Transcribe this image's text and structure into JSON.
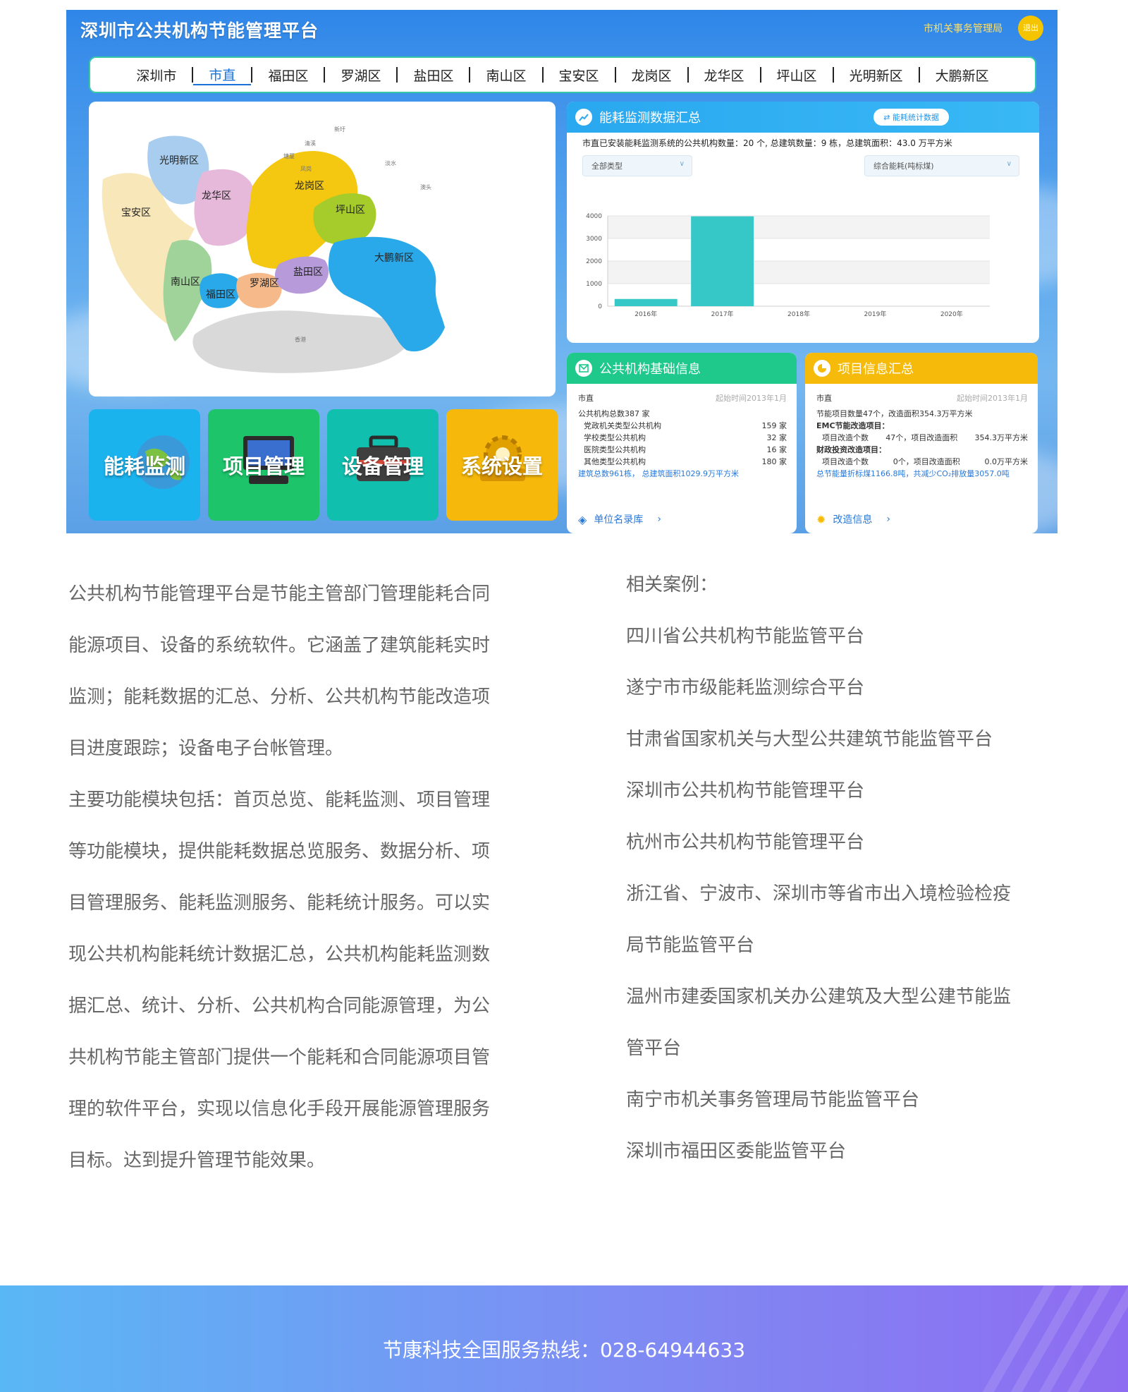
{
  "app": {
    "title": "深圳市公共机构节能管理平台",
    "org": "市机关事务管理局",
    "logout": "退出"
  },
  "nav": [
    "深圳市",
    "市直",
    "福田区",
    "罗湖区",
    "盐田区",
    "南山区",
    "宝安区",
    "龙岗区",
    "龙华区",
    "坪山区",
    "光明新区",
    "大鹏新区"
  ],
  "nav_active": "市直",
  "map": {
    "regions": [
      "光明新区",
      "龙华区",
      "宝安区",
      "龙岗区",
      "坪山区",
      "大鹏新区",
      "南山区",
      "福田区",
      "罗湖区",
      "盐田区",
      "香港"
    ],
    "small_labels": [
      "清溪",
      "新圩",
      "塘厦",
      "凤岗",
      "淡水",
      "澳头"
    ]
  },
  "tiles": [
    "能耗监测",
    "项目管理",
    "设备管理",
    "系统设置"
  ],
  "energy": {
    "title": "能耗监测数据汇总",
    "stat_button": "能耗统计数据",
    "summary": "市直已安装能耗监测系统的公共机构数量：20 个, 总建筑数量：9 栋，总建筑面积：43.0 万平方米",
    "type_select": "全部类型",
    "metric_select": "综合能耗(吨标煤)"
  },
  "chart_data": {
    "type": "bar",
    "categories": [
      "2016年",
      "2017年",
      "2018年",
      "2019年",
      "2020年"
    ],
    "values": [
      320,
      3980,
      0,
      0,
      0
    ],
    "ylim": [
      0,
      4000
    ],
    "yticks": [
      0,
      1000,
      2000,
      3000,
      4000
    ],
    "grid": true,
    "colors": [
      "#36c7c7"
    ]
  },
  "basic": {
    "title": "公共机构基础信息",
    "scope": "市直",
    "since": "起始时间2013年1月",
    "total": "公共机构总数387 家",
    "rows": [
      {
        "label": "党政机关类型公共机构",
        "value": "159 家"
      },
      {
        "label": "学校类型公共机构",
        "value": "32 家"
      },
      {
        "label": "医院类型公共机构",
        "value": "16 家"
      },
      {
        "label": "其他类型公共机构",
        "value": "180 家"
      }
    ],
    "buildings": "建筑总数961栋， 总建筑面积1029.9万平方米",
    "footer_link": "单位名录库"
  },
  "project": {
    "title": "项目信息汇总",
    "scope": "市直",
    "since": "起始时间2013年1月",
    "line1": "节能项目数量47个，改造面积354.3万平方米",
    "emc_title": "EMC节能改造项目：",
    "emc_row": {
      "label": "项目改造个数",
      "count": "47个，项目改造面积",
      "area": "354.3万平方米"
    },
    "fin_title": "财政投资改造项目：",
    "fin_row": {
      "label": "项目改造个数",
      "count": "0个，项目改造面积",
      "area": "0.0万平方米"
    },
    "saving": "总节能量折标煤1166.8吨，共减少CO₂排放量3057.0吨",
    "footer_link": "改造信息"
  },
  "intro": [
    "公共机构节能管理平台是节能主管部门管理能耗合同",
    "能源项目、设备的系统软件。它涵盖了建筑能耗实时",
    "监测；能耗数据的汇总、分析、公共机构节能改造项",
    "目进度跟踪；设备电子台帐管理。",
    "主要功能模块包括：首页总览、能耗监测、项目管理",
    "等功能模块，提供能耗数据总览服务、数据分析、项",
    "目管理服务、能耗监测服务、能耗统计服务。可以实",
    "现公共机构能耗统计数据汇总，公共机构能耗监测数",
    "据汇总、统计、分析、公共机构合同能源管理，为公",
    "共机构节能主管部门提供一个能耗和合同能源项目管",
    "理的软件平台，实现以信息化手段开展能源管理服务",
    "目标。达到提升管理节能效果。"
  ],
  "cases": {
    "heading": "相关案例：",
    "lines": [
      "四川省公共机构节能监管平台",
      "遂宁市市级能耗监测综合平台",
      "甘肃省国家机关与大型公共建筑节能监管平台",
      "深圳市公共机构节能管理平台",
      "杭州市公共机构节能管理平台",
      "浙江省、宁波市、深圳市等省市出入境检验检疫",
      "局节能监管平台",
      "温州市建委国家机关办公建筑及大型公建节能监",
      "管平台",
      "南宁市机关事务管理局节能监管平台",
      "深圳市福田区委能监管平台"
    ]
  },
  "footer": {
    "hotline": "节康科技全国服务热线：028-64944633"
  }
}
